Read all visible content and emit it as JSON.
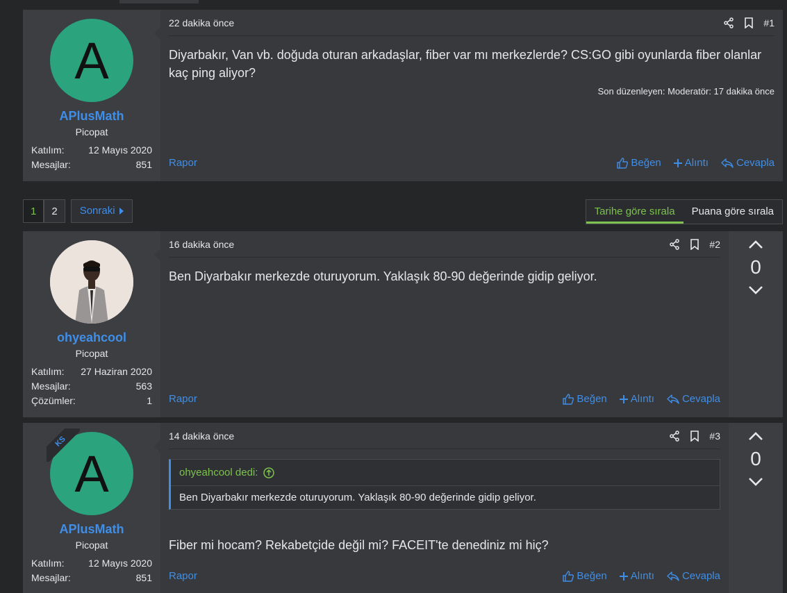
{
  "colors": {
    "accent": "#3f8ee8",
    "green": "#7cc24c",
    "avatar_green": "#2ba37c"
  },
  "posts": [
    {
      "user": {
        "avatar_letter": "A",
        "name": "APlusMath",
        "title": "Picopat",
        "stats": [
          {
            "label": "Katılım:",
            "value": "12 Mayıs 2020"
          },
          {
            "label": "Mesajlar:",
            "value": "851"
          }
        ]
      },
      "time": "22 dakika önce",
      "number": "#1",
      "body": "Diyarbakır, Van vb. doğuda oturan arkadaşlar, fiber var mı merkezlerde? CS:GO gibi oyunlarda fiber olanlar kaç ping aliyor?",
      "edited": "Son düzenleyen: Moderatör: 17 dakika önce"
    },
    {
      "user": {
        "name": "ohyeahcool",
        "title": "Picopat",
        "stats": [
          {
            "label": "Katılım:",
            "value": "27 Haziran 2020"
          },
          {
            "label": "Mesajlar:",
            "value": "563"
          },
          {
            "label": "Çözümler:",
            "value": "1"
          }
        ]
      },
      "time": "16 dakika önce",
      "number": "#2",
      "body": "Ben Diyarbakır merkezde oturuyorum. Yaklaşık 80-90 değerinde gidip geliyor.",
      "score": "0"
    },
    {
      "user": {
        "avatar_letter": "A",
        "badge": "KS",
        "name": "APlusMath",
        "title": "Picopat",
        "stats": [
          {
            "label": "Katılım:",
            "value": "12 Mayıs 2020"
          },
          {
            "label": "Mesajlar:",
            "value": "851"
          }
        ]
      },
      "time": "14 dakika önce",
      "number": "#3",
      "quote": {
        "author": "ohyeahcool dedi:",
        "text": "Ben Diyarbakır merkezde oturuyorum. Yaklaşık 80-90 değerinde gidip geliyor."
      },
      "body": "Fiber mi hocam? Rekabetçide değil mi? FACEIT'te denediniz mi hiç?",
      "score": "0"
    }
  ],
  "actions": {
    "report": "Rapor",
    "like": "Beğen",
    "quote": "Alıntı",
    "reply": "Cevapla"
  },
  "pager": {
    "pages": [
      "1",
      "2"
    ],
    "next": "Sonraki"
  },
  "sort": {
    "by_date": "Tarihe göre sırala",
    "by_score": "Puana göre sırala"
  },
  "icons": [
    "share-icon",
    "bookmark-icon",
    "thumbs-up-icon",
    "plus-icon",
    "reply-icon",
    "chevron-up-icon",
    "chevron-down-icon",
    "caret-right-icon",
    "arrow-up-circle-icon"
  ]
}
